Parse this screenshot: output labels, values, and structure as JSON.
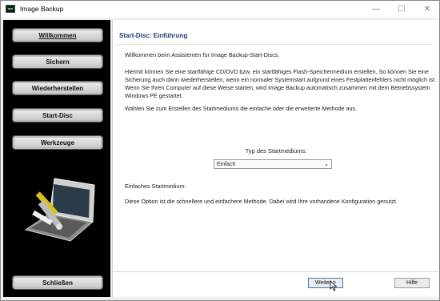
{
  "window": {
    "title": "Image Backup",
    "controls": [
      "—",
      "☐",
      "✕"
    ]
  },
  "sidebar": {
    "items": [
      {
        "label": "Willkommen",
        "active": true
      },
      {
        "label": "Sichern",
        "active": false
      },
      {
        "label": "Wiederherstellen",
        "active": false
      },
      {
        "label": "Start-Disc",
        "active": false
      },
      {
        "label": "Werkzeuge",
        "active": false
      }
    ],
    "close_label": "Schließen",
    "hero_icon": "laptop-with-tools"
  },
  "main": {
    "heading": "Start-Disc: Einführung",
    "intro": "Willkommen beim Assistenten für Image Backup-Start-Discs.",
    "body1": "Hiermit können Sie eine startfähige CD/DVD bzw. ein startfähiges Flash-Speichermedium erstellen. So können Sie eine Sicherung auch dann wiederherstellen, wenn ein normaler Systemstart aufgrund eines Festplattenfehlers nicht möglich ist. Wenn Sie Ihren Computer auf diese Weise starten, wird Image Backup automatisch zusammen mit dem Betriebssystem Windows PE gestartet.",
    "body2": "Wählen Sie zum Erstellen des Startmediums die einfache oder die erweiterte Methode aus.",
    "type_label": "Typ des Startmediums:",
    "type_value": "Einfach",
    "desc_label": "Einfaches Startmedium:",
    "desc_text": "Diese Option ist die schnellere und einfachere Methode. Dabei wird Ihre vorhandene Konfiguration genutzt."
  },
  "footer": {
    "next_label": "Weiter >",
    "help_label": "Hilfe"
  },
  "colors": {
    "sidebar_bg": "#000000",
    "heading": "#1f3d7a",
    "button_focus": "#3b78c9"
  }
}
